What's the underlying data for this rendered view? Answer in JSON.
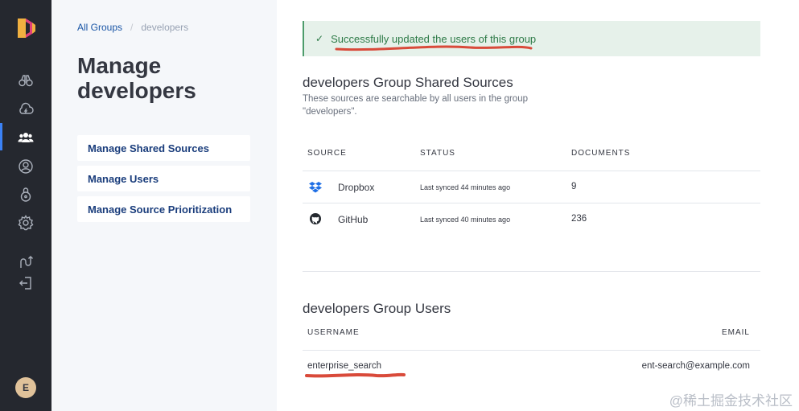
{
  "breadcrumb": {
    "root": "All Groups",
    "separator": "/",
    "current": "developers"
  },
  "page_title": "Manage developers",
  "nav": {
    "items": [
      {
        "label": "Manage Shared Sources"
      },
      {
        "label": "Manage Users"
      },
      {
        "label": "Manage Source Prioritization"
      }
    ]
  },
  "toast": {
    "message": "Successfully updated the users of this group"
  },
  "shared_sources": {
    "title": "developers Group Shared Sources",
    "description": "These sources are searchable by all users in the group \"developers\".",
    "columns": {
      "source": "SOURCE",
      "status": "STATUS",
      "documents": "DOCUMENTS"
    },
    "rows": [
      {
        "icon": "dropbox-icon",
        "name": "Dropbox",
        "status": "Last synced 44 minutes ago",
        "documents": "9"
      },
      {
        "icon": "github-icon",
        "name": "GitHub",
        "status": "Last synced 40 minutes ago",
        "documents": "236"
      }
    ]
  },
  "group_users": {
    "title": "developers Group Users",
    "columns": {
      "username": "USERNAME",
      "email": "EMAIL"
    },
    "rows": [
      {
        "username": "enterprise_search",
        "email": "ent-search@example.com"
      }
    ]
  },
  "user": {
    "avatar_initial": "E"
  },
  "watermark": "@稀土掘金技术社区",
  "colors": {
    "rail": "#25282f",
    "panel": "#f5f7fa",
    "success": "#2d7a47",
    "link": "#1a56a6",
    "annotation": "#d94a3a"
  }
}
